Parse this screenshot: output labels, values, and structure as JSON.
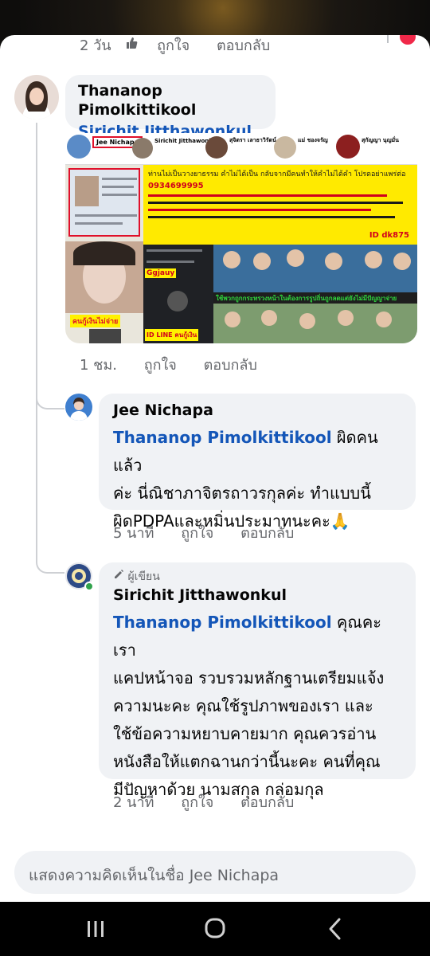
{
  "top_comment": {
    "time": "2 วัน",
    "like": "ถูกใจ",
    "reply": "ตอบกลับ"
  },
  "comment1": {
    "author": "Thananop Pimolkittikool",
    "tag": "Sirichit Jitthawonkul",
    "time": "1 ชม.",
    "like": "ถูกใจ",
    "reply": "ตอบกลับ",
    "image": {
      "profiles": [
        "Jee Nichapa",
        "Sirichit Jitthawonkul",
        "สุจิตรา เลาธาวิรัตน์",
        "แม่ ชองจรัญ",
        "สุกัญญา นุญมั่น"
      ],
      "headline": "ท่านไม่เป็นวางยาธรรม คำไม่ได้เป็น กลับจากมีคนทำให้คำไม่ได้คำ โปรดอย่าแพร่ต่อ",
      "phone": "0934699995",
      "line_id": "ID dk875",
      "label_left": "คนกู้เงินไม่จ่าย",
      "label_mid1": "Ggjauy",
      "label_mid2": "ID LINE คนกู้เงิน",
      "label_right": "ใช้พวกถูกกระทรวงหน้าในต้องการรูปถิ่นถูกลดแต่ยังไม่มีปัญญาจ่าย"
    }
  },
  "reply1": {
    "author": "Jee Nichapa",
    "tag": "Thananop Pimolkittikool",
    "text_line1": " ผิดคนแล้ว",
    "text_line2": "ค่ะ นี่ณิชาภาจิตรถาวรกุลค่ะ ทำแบบนี้",
    "text_line3": "ผิดPDPAและหมิ่นประมาทนะคะ🙏",
    "time": "5 นาที",
    "like": "ถูกใจ",
    "reply": "ตอบกลับ"
  },
  "reply2": {
    "badge": "ผู้เขียน",
    "author": "Sirichit Jitthawonkul",
    "tag": "Thananop Pimolkittikool",
    "text_line1": " คุณคะ เรา",
    "text_line2": "แคปหน้าจอ รวบรวมหลักฐานเตรียมแจ้ง",
    "text_line3": "ความนะคะ คุณใช้รูปภาพของเรา และ",
    "text_line4": "ใช้ข้อความหยาบคายมาก คุณควรอ่าน",
    "text_line5": "หนังสือให้แตกฉานกว่านี้นะคะ คนที่คุณ",
    "text_line6": "มีปัญหาด้วย นามสกุล กล่อมกุล",
    "time": "2 นาที",
    "like": "ถูกใจ",
    "reply": "ตอบกลับ"
  },
  "composer": {
    "placeholder": "แสดงความคิดเห็นในชื่อ Jee Nichapa"
  },
  "colors": {
    "tag_blue": "#1456b8",
    "reaction_red": "#f02849",
    "bubble_bg": "#f0f2f5"
  },
  "icons": [
    "like-reaction-icon",
    "pencil-icon",
    "recent-apps-icon",
    "home-icon",
    "back-icon"
  ]
}
